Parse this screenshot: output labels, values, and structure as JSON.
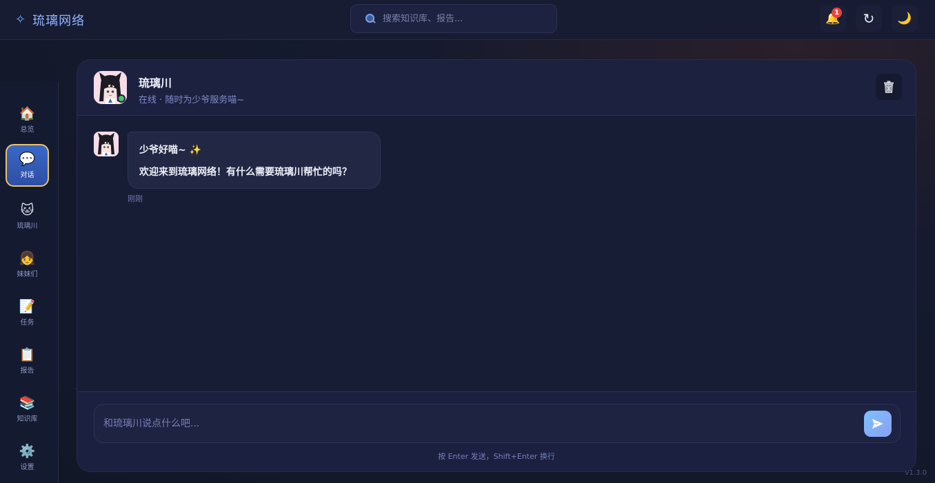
{
  "app": {
    "brand_icon": "sparkle-icon",
    "brand_name": "琉璃网络",
    "version": "v1.3.0"
  },
  "search": {
    "placeholder": "搜索知识库、报告..."
  },
  "topbar": {
    "notification_count": "1",
    "refresh_glyph": "↻"
  },
  "sidebar": {
    "items": [
      {
        "label": "总览",
        "icon": "house-icon",
        "glyph": "🏠"
      },
      {
        "label": "对话",
        "icon": "speech-bubble-icon",
        "glyph": "💬",
        "active": true
      },
      {
        "label": "琉璃川",
        "icon": "cat-face-icon",
        "glyph": "🐱"
      },
      {
        "label": "妹妹们",
        "icon": "girl-face-icon",
        "glyph": "👧"
      },
      {
        "label": "任务",
        "icon": "memo-icon",
        "glyph": "📝"
      },
      {
        "label": "报告",
        "icon": "clipboard-icon",
        "glyph": "📋"
      },
      {
        "label": "知识库",
        "icon": "books-icon",
        "glyph": "📚"
      },
      {
        "label": "设置",
        "icon": "gear-icon",
        "glyph": "⚙️"
      }
    ]
  },
  "chat": {
    "name": "琉璃川",
    "status": "在线 · 随时为少爷服务喵~",
    "messages": [
      {
        "line1": "少爷好喵~ ✨",
        "line2": "欢迎来到琉璃网络！有什么需要琉璃川帮忙的吗？",
        "time": "刚刚"
      }
    ],
    "input_placeholder": "和琉璃川说点什么吧...",
    "hint": "按 Enter 发送，Shift+Enter 换行"
  },
  "colors": {
    "accent": "#6ea6ff",
    "active_nav": "#3a68c8",
    "active_border": "#e8c46a",
    "online": "#4cc463",
    "badge": "#e8443f"
  }
}
